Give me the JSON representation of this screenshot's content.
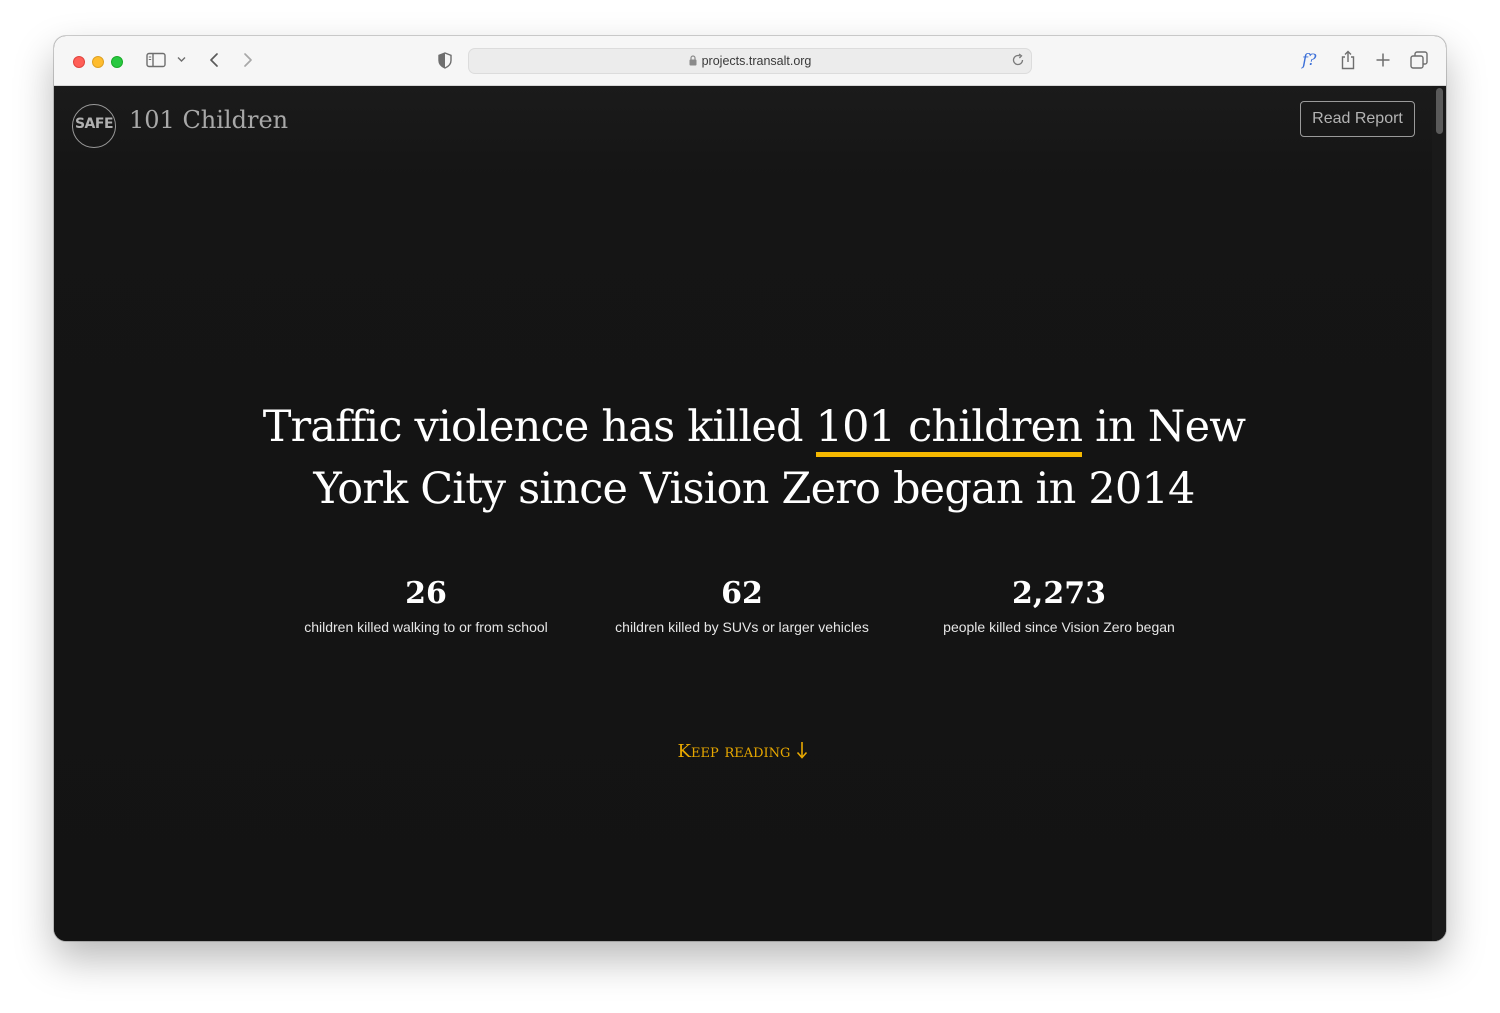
{
  "browser": {
    "url": "projects.transalt.org",
    "fx_label": "f?"
  },
  "site": {
    "logo_text": "SAFE",
    "title": "101 Children",
    "read_report": "Read Report"
  },
  "hero": {
    "headline_pre": "Traffic violence has killed ",
    "headline_highlight": "101 children",
    "headline_post": " in New York City since Vision Zero began in 2014"
  },
  "stats": [
    {
      "number": "26",
      "label": "children killed walking to or from school"
    },
    {
      "number": "62",
      "label": "children killed by SUVs or larger vehicles"
    },
    {
      "number": "2,273",
      "label": "people killed since Vision Zero began"
    }
  ],
  "keep_reading": {
    "label": "Keep reading"
  },
  "colors": {
    "accent": "#f5b800",
    "background": "#141414"
  }
}
